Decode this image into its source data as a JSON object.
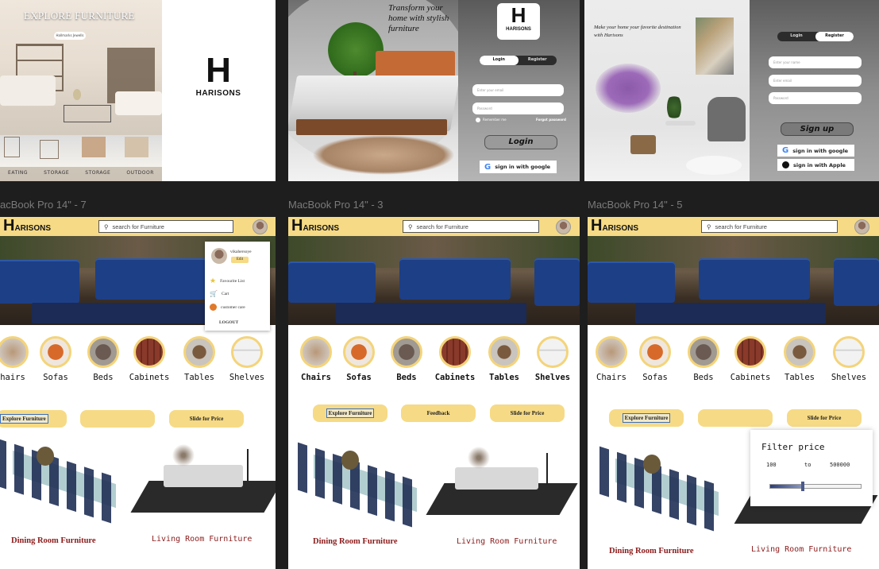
{
  "top_left": {
    "title": "EXPLORE FURNITURE",
    "pill": "Hallmarks Jewells",
    "categories": [
      "EATING",
      "STORAGE",
      "STORAGE",
      "OUTDOOR"
    ],
    "logo_letter": "H",
    "logo_word": "HARISONS"
  },
  "login_card": {
    "tagline": "Transform your home with stylish furniture",
    "logo_letter": "H",
    "logo_word": "HARISONS",
    "tab_login": "Login",
    "tab_register": "Register",
    "email_placeholder": "Enter your email",
    "password_placeholder": "Password",
    "remember": "Remember me",
    "forgot": "Forgot password",
    "login_button": "Login",
    "google_button": "sign in with google"
  },
  "signup_card": {
    "tagline": "Make your home your favorite destination with Harisons",
    "tab_login": "Login",
    "tab_register": "Register",
    "name_placeholder": "Enter your name",
    "email_placeholder": "Enter email",
    "password_placeholder": "Password",
    "signup_button": "Sign up",
    "google_button": "sign in with google",
    "apple_button": "sign in with Apple"
  },
  "frame_labels": [
    "acBook Pro 14\" - 7",
    "MacBook Pro 14\" - 3",
    "MacBook Pro 14\" - 5"
  ],
  "frames": [
    {
      "brand_letter": "H",
      "brand_rest": "ARISONS",
      "search_placeholder": "search for Furniture",
      "categories": [
        "hairs",
        "Sofas",
        "Beds",
        "Cabinets",
        "Tables",
        "Shelves"
      ],
      "buttons": [
        "Explore Furniture",
        "",
        "Slide for Price"
      ],
      "left_title": "Dining Room Furniture",
      "right_title": "Living Room Furniture"
    },
    {
      "brand_letter": "H",
      "brand_rest": "ARISONS",
      "search_placeholder": "search for Furniture",
      "categories": [
        "Chairs",
        "Sofas",
        "Beds",
        "Cabinets",
        "Tables",
        "Shelves"
      ],
      "buttons": [
        "Explore Furniture",
        "Feedback",
        "Slide for Price"
      ],
      "left_title": "Dining Room Furniture",
      "right_title": "Living Room Furniture"
    },
    {
      "brand_letter": "H",
      "brand_rest": "ARISONS",
      "search_placeholder": "search for Furniture",
      "categories": [
        "Chairs",
        "Sofas",
        "Beds",
        "Cabinets",
        "Tables",
        "Shelves"
      ],
      "buttons": [
        "Explore Furniture",
        "",
        "Slide for Price"
      ],
      "left_title": "Dining Room Furniture",
      "right_title": "Living Room Furniture"
    }
  ],
  "profile_menu": {
    "username": "vikahersoye",
    "edit": "Edit",
    "items": [
      "Favourite List",
      "Cart",
      "customer care"
    ],
    "logout": "LOGOUT"
  },
  "filter_panel": {
    "title": "Filter price",
    "min": "100",
    "to": "to",
    "max": "500000",
    "slider_value_fraction": 0.36
  },
  "colors": {
    "accent": "#f6da85",
    "title_red": "#8b1c1c",
    "sofa_blue": "#1d3f86"
  }
}
